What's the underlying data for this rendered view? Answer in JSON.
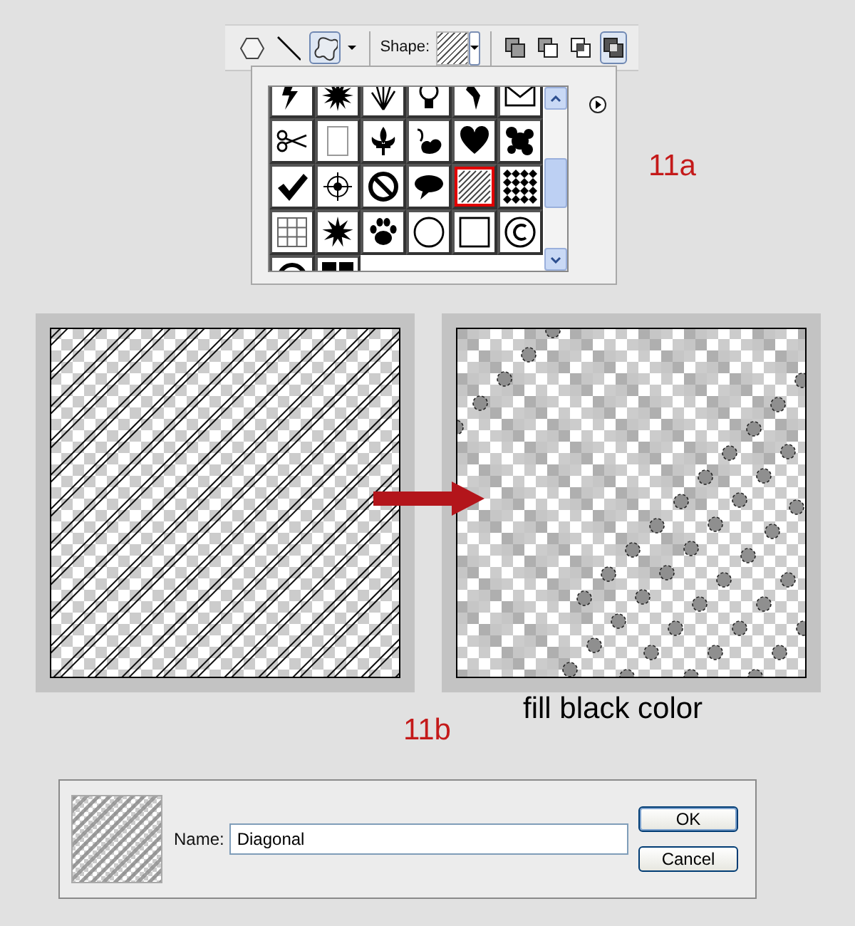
{
  "toolbar": {
    "tools": [
      {
        "kind": "polygon",
        "selected": false
      },
      {
        "kind": "line",
        "selected": false
      },
      {
        "kind": "custom",
        "selected": true
      }
    ],
    "shape_label": "Shape:",
    "combine_modes": [
      {
        "kind": "add",
        "selected": false
      },
      {
        "kind": "subtract",
        "selected": false
      },
      {
        "kind": "intersect",
        "selected": false
      },
      {
        "kind": "exclude",
        "selected": true
      }
    ]
  },
  "shape_picker": {
    "shapes": [
      {
        "kind": "lightning",
        "selected": false
      },
      {
        "kind": "burst",
        "selected": false
      },
      {
        "kind": "grass",
        "selected": false
      },
      {
        "kind": "bulb",
        "selected": false
      },
      {
        "kind": "nib",
        "selected": false
      },
      {
        "kind": "envelope",
        "selected": false
      },
      {
        "kind": "scissors",
        "selected": false
      },
      {
        "kind": "frame",
        "selected": false
      },
      {
        "kind": "fleur",
        "selected": false
      },
      {
        "kind": "ornament",
        "selected": false
      },
      {
        "kind": "heart",
        "selected": false
      },
      {
        "kind": "splat",
        "selected": false
      },
      {
        "kind": "check",
        "selected": false
      },
      {
        "kind": "target",
        "selected": false
      },
      {
        "kind": "forbidden",
        "selected": false
      },
      {
        "kind": "speech",
        "selected": false
      },
      {
        "kind": "hatch",
        "selected": true
      },
      {
        "kind": "diamonds",
        "selected": false
      },
      {
        "kind": "grid",
        "selected": false
      },
      {
        "kind": "star",
        "selected": false
      },
      {
        "kind": "paw",
        "selected": false
      },
      {
        "kind": "circle",
        "selected": false
      },
      {
        "kind": "square",
        "selected": false
      },
      {
        "kind": "copyright",
        "selected": false
      },
      {
        "kind": "ring",
        "selected": false
      },
      {
        "kind": "bars",
        "selected": false
      }
    ]
  },
  "figure_a": {
    "label": "11a"
  },
  "figure_b": {
    "label": "11b",
    "caption": "fill black color"
  },
  "dialog": {
    "name_label": "Name:",
    "name_value": "Diagonal",
    "buttons": [
      {
        "label": "OK",
        "default": true
      },
      {
        "label": "Cancel",
        "default": false
      }
    ]
  }
}
